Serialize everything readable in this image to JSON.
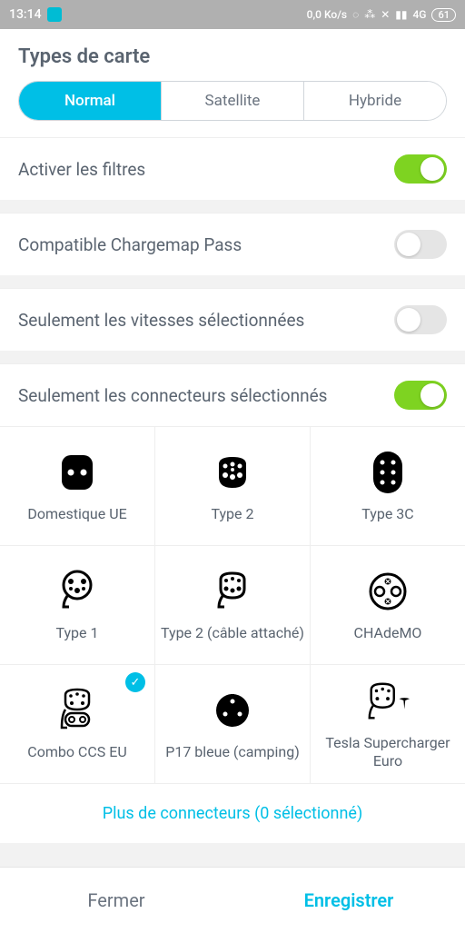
{
  "status": {
    "time": "13:14",
    "net": "0,0 Ko/s",
    "signal": "4G",
    "battery": "61"
  },
  "title": "Types de carte",
  "tabs": [
    {
      "label": "Normal",
      "active": true
    },
    {
      "label": "Satellite",
      "active": false
    },
    {
      "label": "Hybride",
      "active": false
    }
  ],
  "filters": {
    "enable": {
      "label": "Activer les filtres",
      "on": true
    },
    "pass": {
      "label": "Compatible Chargemap Pass",
      "on": false
    },
    "speeds": {
      "label": "Seulement les vitesses sélectionnées",
      "on": false
    },
    "connectors": {
      "label": "Seulement les connecteurs sélectionnés",
      "on": true
    }
  },
  "connectors": [
    {
      "label": "Domestique UE",
      "selected": false
    },
    {
      "label": "Type 2",
      "selected": false
    },
    {
      "label": "Type 3C",
      "selected": false
    },
    {
      "label": "Type 1",
      "selected": false
    },
    {
      "label": "Type 2 (câble attaché)",
      "selected": false
    },
    {
      "label": "CHAdeMO",
      "selected": false
    },
    {
      "label": "Combo CCS EU",
      "selected": true
    },
    {
      "label": "P17 bleue (camping)",
      "selected": false
    },
    {
      "label": "Tesla Supercharger Euro",
      "selected": false
    }
  ],
  "more": "Plus de connecteurs (0 sélectionné)",
  "footer": {
    "close": "Fermer",
    "save": "Enregistrer"
  }
}
